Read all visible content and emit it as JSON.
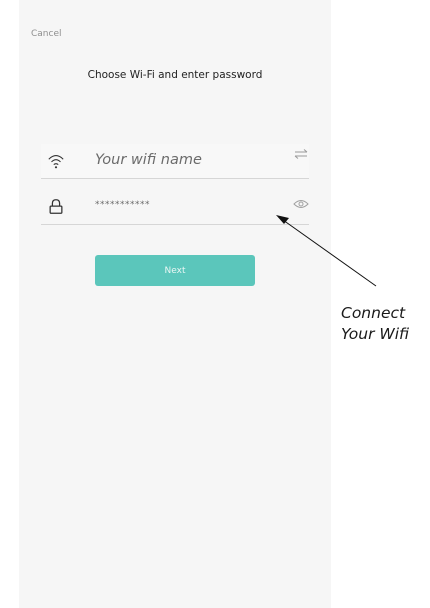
{
  "header": {
    "cancel_label": "Cancel"
  },
  "title": "Choose Wi-Fi and enter password",
  "wifi_field": {
    "value": "Your wifi name",
    "icon": "wifi-icon",
    "action_icon": "swap-icon"
  },
  "password_field": {
    "value": "***********",
    "icon": "lock-icon",
    "action_icon": "eye-icon"
  },
  "next_button": {
    "label": "Next"
  },
  "annotation": {
    "line1": "Connect",
    "line2": "Your Wifi"
  },
  "colors": {
    "accent": "#5bc6bb",
    "background": "#f6f6f6"
  }
}
